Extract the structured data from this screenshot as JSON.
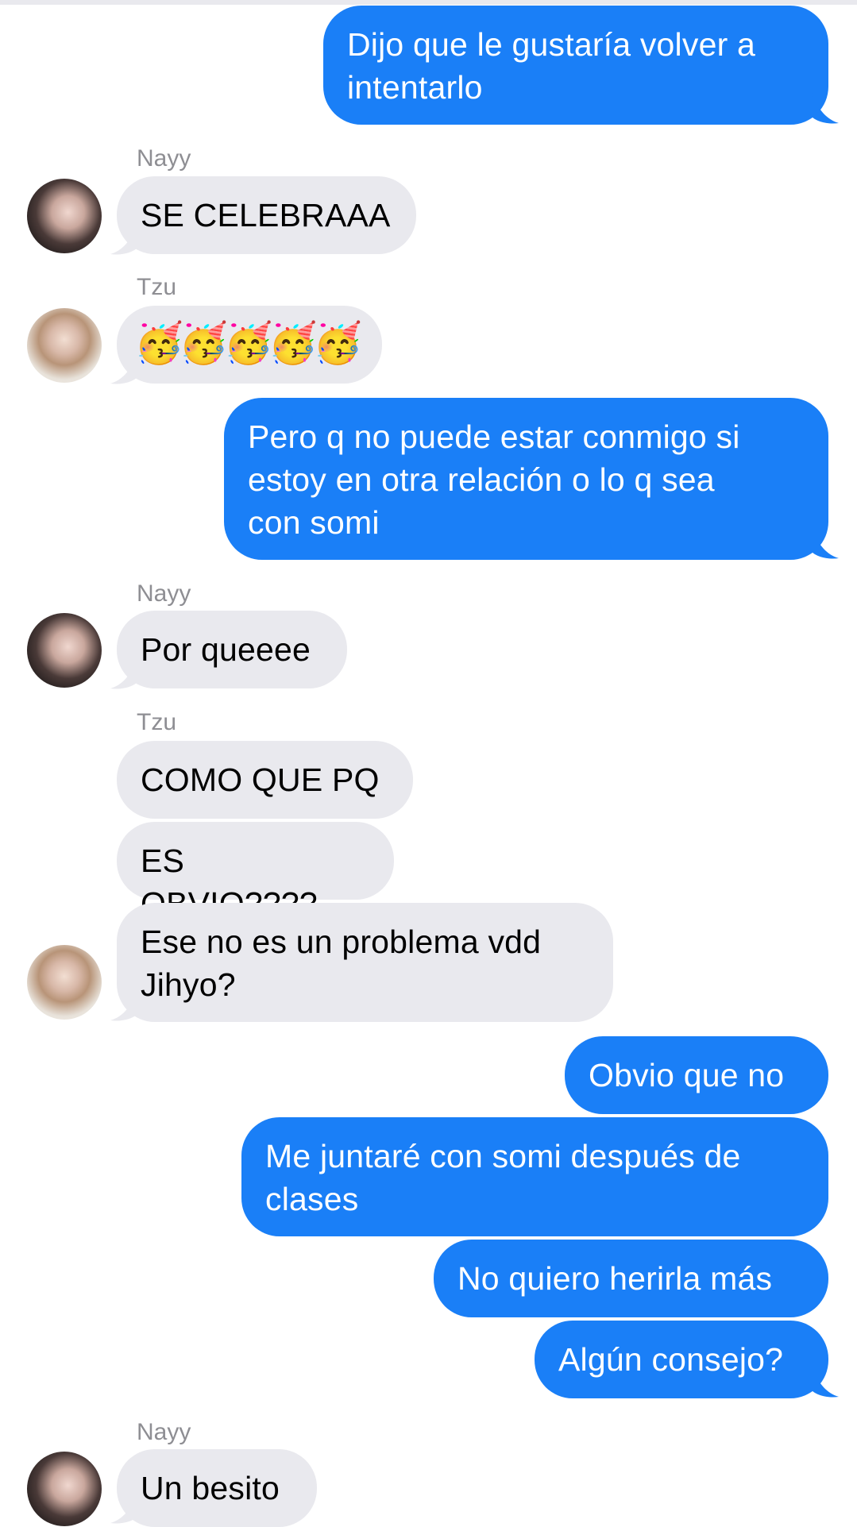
{
  "conversation": {
    "messages": [
      {
        "id": "m1",
        "side": "out",
        "text": "Dijo que le gustaría volver a\nintentarlo"
      },
      {
        "id": "m2",
        "side": "in",
        "sender": "Nayy",
        "text": "SE CELEBRAAA"
      },
      {
        "id": "m3",
        "side": "in",
        "sender": "Tzu",
        "text": "🥳🥳🥳🥳🥳"
      },
      {
        "id": "m4",
        "side": "out",
        "text": "Pero q no puede estar conmigo si\nestoy en otra relación o lo q sea\ncon somi"
      },
      {
        "id": "m5",
        "side": "in",
        "sender": "Nayy",
        "text": "Por queeee"
      },
      {
        "id": "m6",
        "side": "in",
        "sender": "Tzu",
        "text": "COMO QUE PQ"
      },
      {
        "id": "m7",
        "side": "in",
        "text": "ES OBVIO????"
      },
      {
        "id": "m8",
        "side": "in",
        "text": "Ese no es un problema vdd\nJihyo?"
      },
      {
        "id": "m9",
        "side": "out",
        "text": "Obvio que no"
      },
      {
        "id": "m10",
        "side": "out",
        "text": "Me juntaré con somi después de\nclases"
      },
      {
        "id": "m11",
        "side": "out",
        "text": "No quiero herirla más"
      },
      {
        "id": "m12",
        "side": "out",
        "text": "Algún consejo?"
      },
      {
        "id": "m13",
        "side": "in",
        "sender": "Nayy",
        "text": "Un besito"
      }
    ]
  },
  "avatars": {
    "nayy": "avatar-nayy",
    "tzu": "avatar-tzu"
  },
  "colors": {
    "outgoing_bubble": "#1a7ff7",
    "incoming_bubble": "#e9e9ee",
    "sender_label": "#8e8e93"
  }
}
